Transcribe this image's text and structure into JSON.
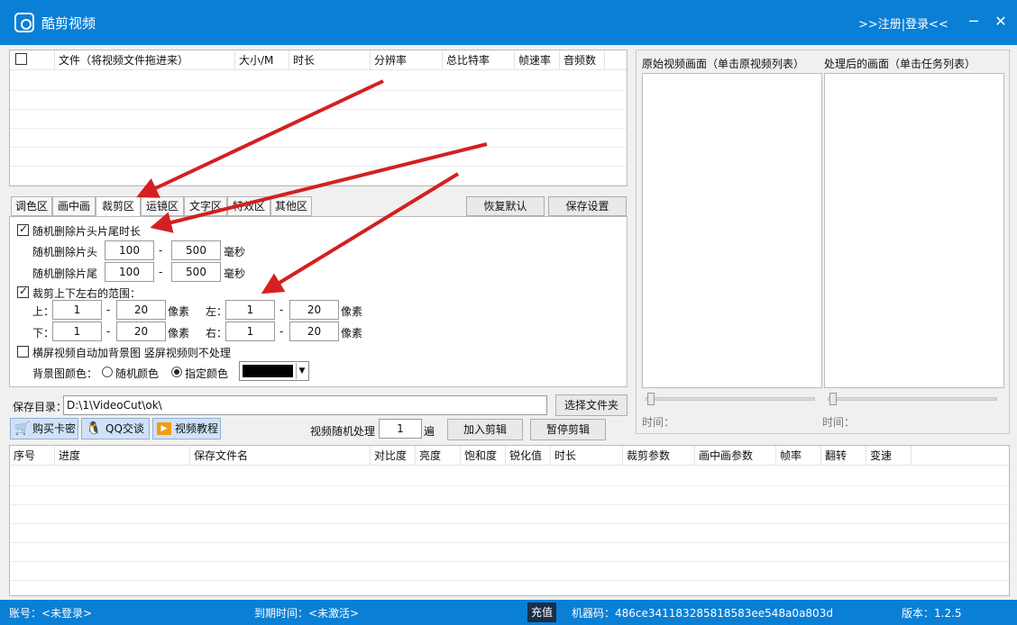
{
  "window": {
    "title": "酷剪视频",
    "register_login": ">>注册|登录<<",
    "minimize": "─",
    "close": "✕"
  },
  "file_table": {
    "headers": [
      "文件（将视频文件拖进来）",
      "大小/M",
      "时长",
      "分辨率",
      "总比特率",
      "帧速率",
      "音频数"
    ]
  },
  "tabs": [
    "调色区",
    "画中画",
    "裁剪区",
    "运镜区",
    "文字区",
    "特效区",
    "其他区"
  ],
  "active_tab": "裁剪区",
  "buttons": {
    "restore_default": "恢复默认",
    "save_settings": "保存设置",
    "choose_folder": "选择文件夹",
    "add_clip": "加入剪辑",
    "pause_clip": "暂停剪辑"
  },
  "crop": {
    "random_delete_label": "随机删除片头片尾时长",
    "head_label": "随机删除片头",
    "head_min": "100",
    "head_max": "500",
    "tail_label": "随机删除片尾",
    "tail_min": "100",
    "tail_max": "500",
    "ms": "毫秒",
    "dash": "-",
    "range_label": "裁剪上下左右的范围：",
    "top_label": "上：",
    "top_min": "1",
    "top_max": "20",
    "bottom_label": "下：",
    "bottom_min": "1",
    "bottom_max": "20",
    "left_label": "左：",
    "left_min": "1",
    "left_max": "20",
    "right_label": "右：",
    "right_min": "1",
    "right_max": "20",
    "px": "像素",
    "landscape_label": "横屏视频自动加背景图 竖屏视频则不处理",
    "bg_color_label": "背景图颜色：",
    "random_color": "随机颜色",
    "specified_color": "指定颜色",
    "swatch_color": "#000000"
  },
  "save_dir": {
    "label": "保存目录：",
    "value": "D:\\1\\VideoCut\\ok\\"
  },
  "toolbar": {
    "buy_card": "购买卡密",
    "qq_chat": "QQ交谈",
    "video_tutorial": "视频教程",
    "random_label": "视频随机处理",
    "random_count": "1",
    "unit": "遍"
  },
  "preview": {
    "original_label": "原始视频画面（单击原视频列表）",
    "processed_label": "处理后的画面（单击任务列表）",
    "time_label": "时间："
  },
  "task_table": {
    "headers": [
      "序号",
      "进度",
      "保存文件名",
      "对比度",
      "亮度",
      "饱和度",
      "锐化值",
      "时长",
      "裁剪参数",
      "画中画参数",
      "帧率",
      "翻转",
      "变速"
    ]
  },
  "status": {
    "account": "账号：<未登录>",
    "expire": "到期时间：<未激活>",
    "recharge": "充值",
    "machine_code": "机器码：486ce341183285818583ee548a0a803d",
    "version": "版本：1.2.5"
  },
  "colors": {
    "accent": "#0a7fd6",
    "arrow": "#d42020"
  }
}
